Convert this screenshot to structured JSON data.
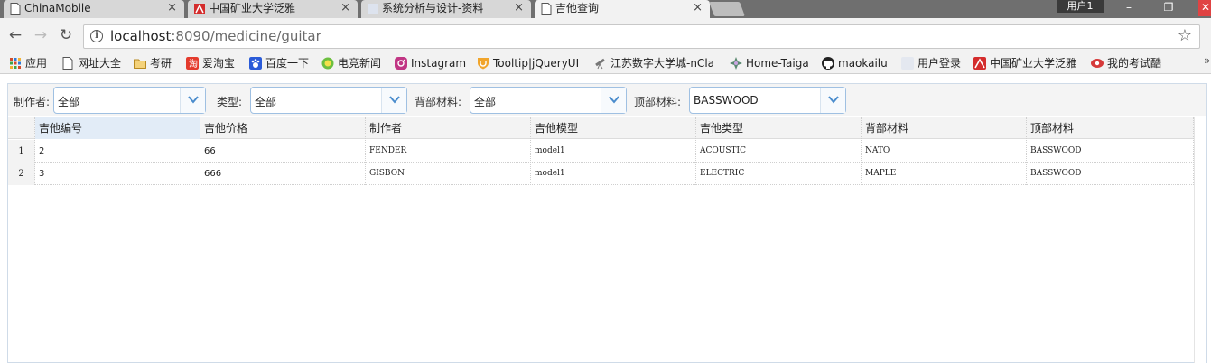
{
  "browser": {
    "tabs": [
      {
        "title": "ChinaMobile",
        "icon": "page-icon",
        "active": false
      },
      {
        "title": "中国矿业大学泛雅",
        "icon": "fanya-logo-icon",
        "active": false
      },
      {
        "title": "系统分析与设计-资料",
        "icon": "blank-favicon-icon",
        "active": false
      },
      {
        "title": "吉他查询",
        "icon": "page-icon",
        "active": true
      }
    ],
    "close_glyph": "×",
    "user_label": "用户1",
    "address": {
      "host": "localhost",
      "path": ":8090/medicine/guitar"
    },
    "bookmarks": [
      {
        "label": "应用",
        "icon": "apps-grid-icon",
        "color": "#d24b2b"
      },
      {
        "label": "网址大全",
        "icon": "page-icon",
        "color": "#ffffff"
      },
      {
        "label": "考研",
        "icon": "folder-icon",
        "color": "#f4c74a"
      },
      {
        "label": "爱淘宝",
        "icon": "aitaobao-icon",
        "color": "#e43b2d"
      },
      {
        "label": "百度一下",
        "icon": "baidu-paw-icon",
        "color": "#2a5bd8"
      },
      {
        "label": "电竞新闻",
        "icon": "esports-icon",
        "color": "#6cbf3f"
      },
      {
        "label": "Instagram",
        "icon": "instagram-icon",
        "color": "#c13584"
      },
      {
        "label": "Tooltip|jQueryUI",
        "icon": "shield-icon",
        "color": "#f1a52b"
      },
      {
        "label": "江苏数字大学城-nCla",
        "icon": "telescope-icon",
        "color": "#888888"
      },
      {
        "label": "Home-Taiga",
        "icon": "taiga-icon",
        "color": "#5b8a72"
      },
      {
        "label": "maokailu",
        "icon": "github-icon",
        "color": "#222222"
      },
      {
        "label": "用户登录",
        "icon": "blank-favicon-icon",
        "color": "#e4e8f0"
      },
      {
        "label": "中国矿业大学泛雅",
        "icon": "fanya-logo-icon",
        "color": "#d42c2c"
      },
      {
        "label": "我的考试酷",
        "icon": "kaoshiku-icon",
        "color": "#d63a3a"
      }
    ],
    "bookmarks_more": "»"
  },
  "filters": [
    {
      "label": "制作者:",
      "value": "全部"
    },
    {
      "label": "类型:",
      "value": "全部"
    },
    {
      "label": "背部材料:",
      "value": "全部"
    },
    {
      "label": "顶部材料:",
      "value": "BASSWOOD"
    }
  ],
  "grid": {
    "columns": [
      "吉他编号",
      "吉他价格",
      "制作者",
      "吉他模型",
      "吉他类型",
      "背部材料",
      "顶部材料"
    ],
    "rows": [
      {
        "num": "1",
        "cells": [
          "2",
          "66",
          "FENDER",
          "model1",
          "ACOUSTIC",
          "NATO",
          "BASSWOOD"
        ]
      },
      {
        "num": "2",
        "cells": [
          "3",
          "666",
          "GISBON",
          "model1",
          "ELECTRIC",
          "MAPLE",
          "BASSWOOD"
        ]
      }
    ]
  },
  "colors": {
    "accent": "#9fc0e2",
    "header_selected": "#e2ecf7"
  }
}
